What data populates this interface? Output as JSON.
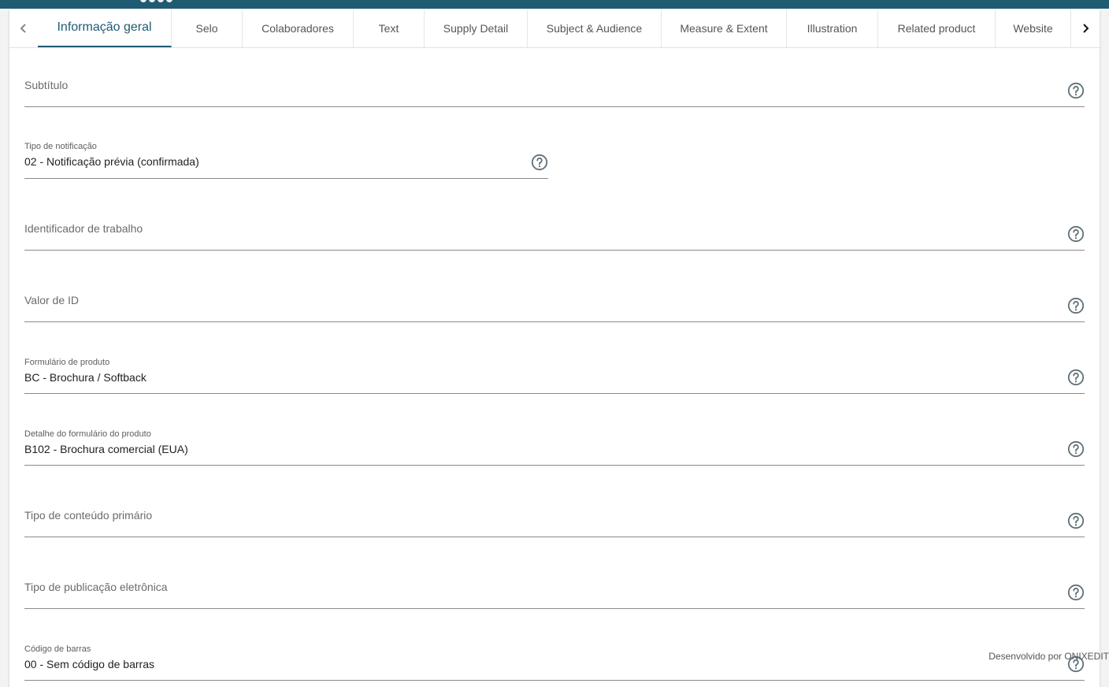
{
  "tabs": [
    {
      "label": "Informação geral",
      "active": true
    },
    {
      "label": "Selo"
    },
    {
      "label": "Colaboradores"
    },
    {
      "label": "Text"
    },
    {
      "label": "Supply Detail"
    },
    {
      "label": "Subject & Audience"
    },
    {
      "label": "Measure & Extent"
    },
    {
      "label": "Illustration"
    },
    {
      "label": "Related product"
    },
    {
      "label": "Website"
    }
  ],
  "fields": {
    "subtitulo": {
      "placeholder": "Subtítulo"
    },
    "tipo_notificacao": {
      "label": "Tipo de notificação",
      "value": "02 - Notificação prévia (confirmada)"
    },
    "identificador_trabalho": {
      "placeholder": "Identificador de trabalho"
    },
    "valor_id": {
      "placeholder": "Valor de ID"
    },
    "formulario_produto": {
      "label": "Formulário de produto",
      "value": "BC - Brochura / Softback"
    },
    "detalhe_formulario": {
      "label": "Detalhe do formulário do produto",
      "value": "B102 - Brochura comercial (EUA)"
    },
    "tipo_conteudo": {
      "placeholder": "Tipo de conteúdo primário"
    },
    "tipo_publicacao": {
      "placeholder": "Tipo de publicação eletrônica"
    },
    "codigo_barras": {
      "label": "Código de barras",
      "value": "00 - Sem código de barras"
    }
  },
  "footer": {
    "text": "Desenvolvido por ONIXEDIT"
  },
  "colors": {
    "accent": "#1f5b73",
    "underline": "#8a8a8a",
    "icon": "#5f6f78"
  }
}
